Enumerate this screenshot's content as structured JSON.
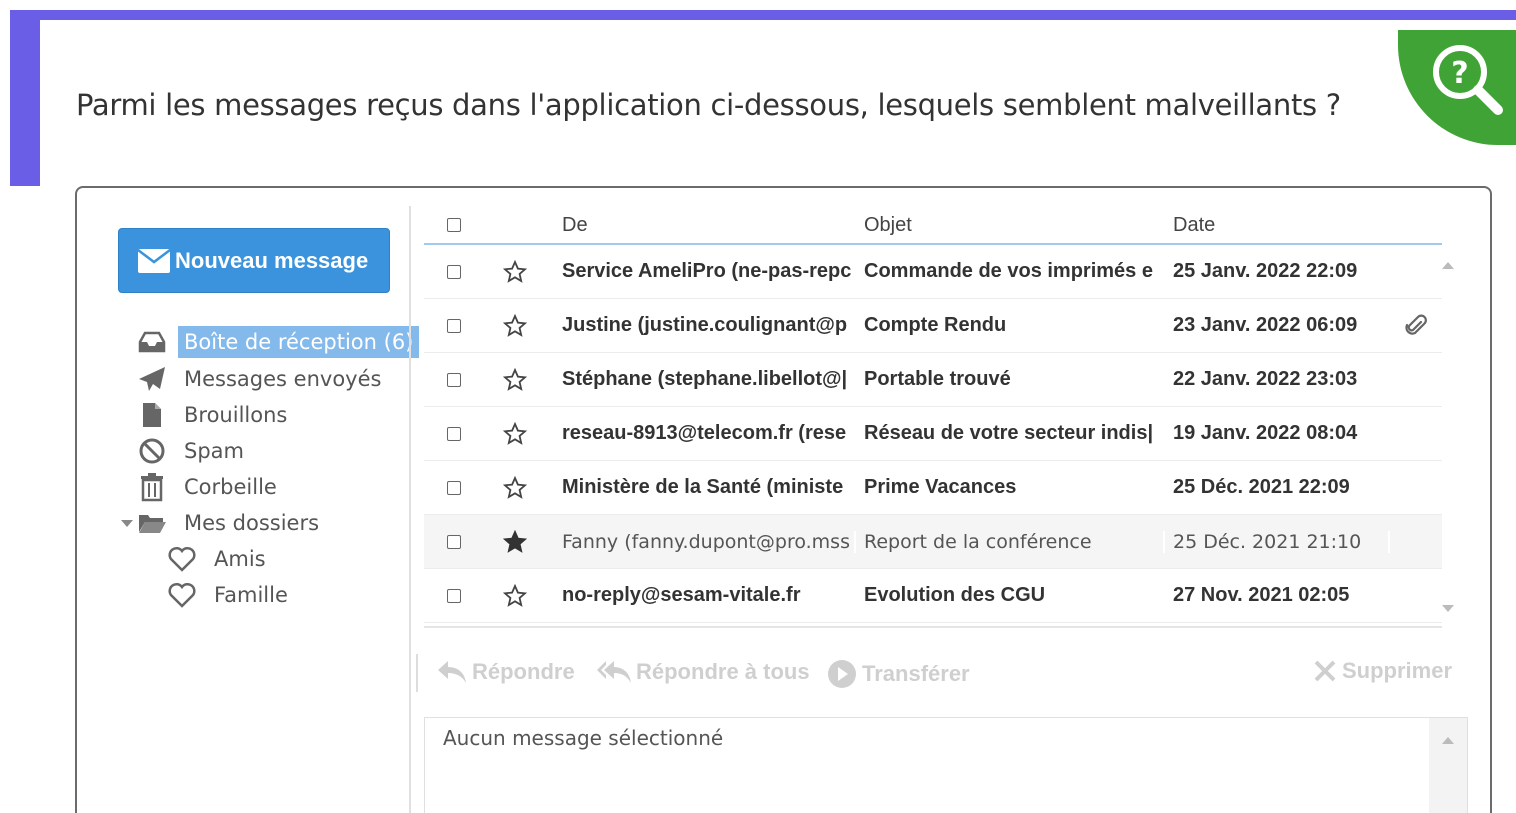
{
  "question": "Parmi les messages reçus dans l'application ci-dessous, lesquels semblent malveillants ?",
  "help": {
    "icon": "search-help-icon",
    "glyph": "?"
  },
  "sidebar": {
    "new_message_label": "Nouveau message",
    "folders": [
      {
        "label": "Boîte de réception (6)",
        "icon": "inbox-icon",
        "active": true
      },
      {
        "label": "Messages envoyés",
        "icon": "paper-plane-icon"
      },
      {
        "label": "Brouillons",
        "icon": "file-icon"
      },
      {
        "label": "Spam",
        "icon": "ban-icon"
      },
      {
        "label": "Corbeille",
        "icon": "trash-icon"
      },
      {
        "label": "Mes dossiers",
        "icon": "folder-open-icon"
      },
      {
        "label": "Amis",
        "icon": "heart-icon"
      },
      {
        "label": "Famille",
        "icon": "heart-icon"
      }
    ]
  },
  "table": {
    "headers": {
      "from": "De",
      "subject": "Objet",
      "date": "Date"
    },
    "rows": [
      {
        "from": "Service AmeliPro (ne-pas-repc",
        "subject": "Commande de vos imprimés e",
        "date": "25 Janv. 2022 22:09",
        "unread": true,
        "starred": false,
        "attachment": false
      },
      {
        "from": "Justine (justine.coulignant@p",
        "subject": "Compte Rendu",
        "date": "23 Janv. 2022 06:09",
        "unread": true,
        "starred": false,
        "attachment": true
      },
      {
        "from": "Stéphane (stephane.libellot@|",
        "subject": "Portable trouvé",
        "date": "22 Janv. 2022 23:03",
        "unread": true,
        "starred": false,
        "attachment": false
      },
      {
        "from": "reseau-8913@telecom.fr (rese",
        "subject": "Réseau de votre secteur indis|",
        "date": "19 Janv. 2022 08:04",
        "unread": true,
        "starred": false,
        "attachment": false
      },
      {
        "from": "Ministère de la Santé (ministe",
        "subject": "Prime Vacances",
        "date": "25 Déc. 2021 22:09",
        "unread": true,
        "starred": false,
        "attachment": false
      },
      {
        "from": "Fanny (fanny.dupont@pro.mss",
        "subject": "Report de la conférence",
        "date": "25 Déc. 2021 21:10",
        "unread": false,
        "starred": true,
        "attachment": false
      },
      {
        "from": "no-reply@sesam-vitale.fr",
        "subject": "Evolution des CGU",
        "date": "27 Nov. 2021 02:05",
        "unread": true,
        "starred": false,
        "attachment": false
      }
    ]
  },
  "toolbar": {
    "reply": "Répondre",
    "reply_all": "Répondre à tous",
    "forward": "Transférer",
    "delete": "Supprimer"
  },
  "preview": {
    "empty_text": "Aucun message sélectionné"
  },
  "colors": {
    "accent": "#6a5ee6",
    "button": "#3a93dc",
    "help": "#3fa335",
    "active_folder": "#84b9ec"
  }
}
